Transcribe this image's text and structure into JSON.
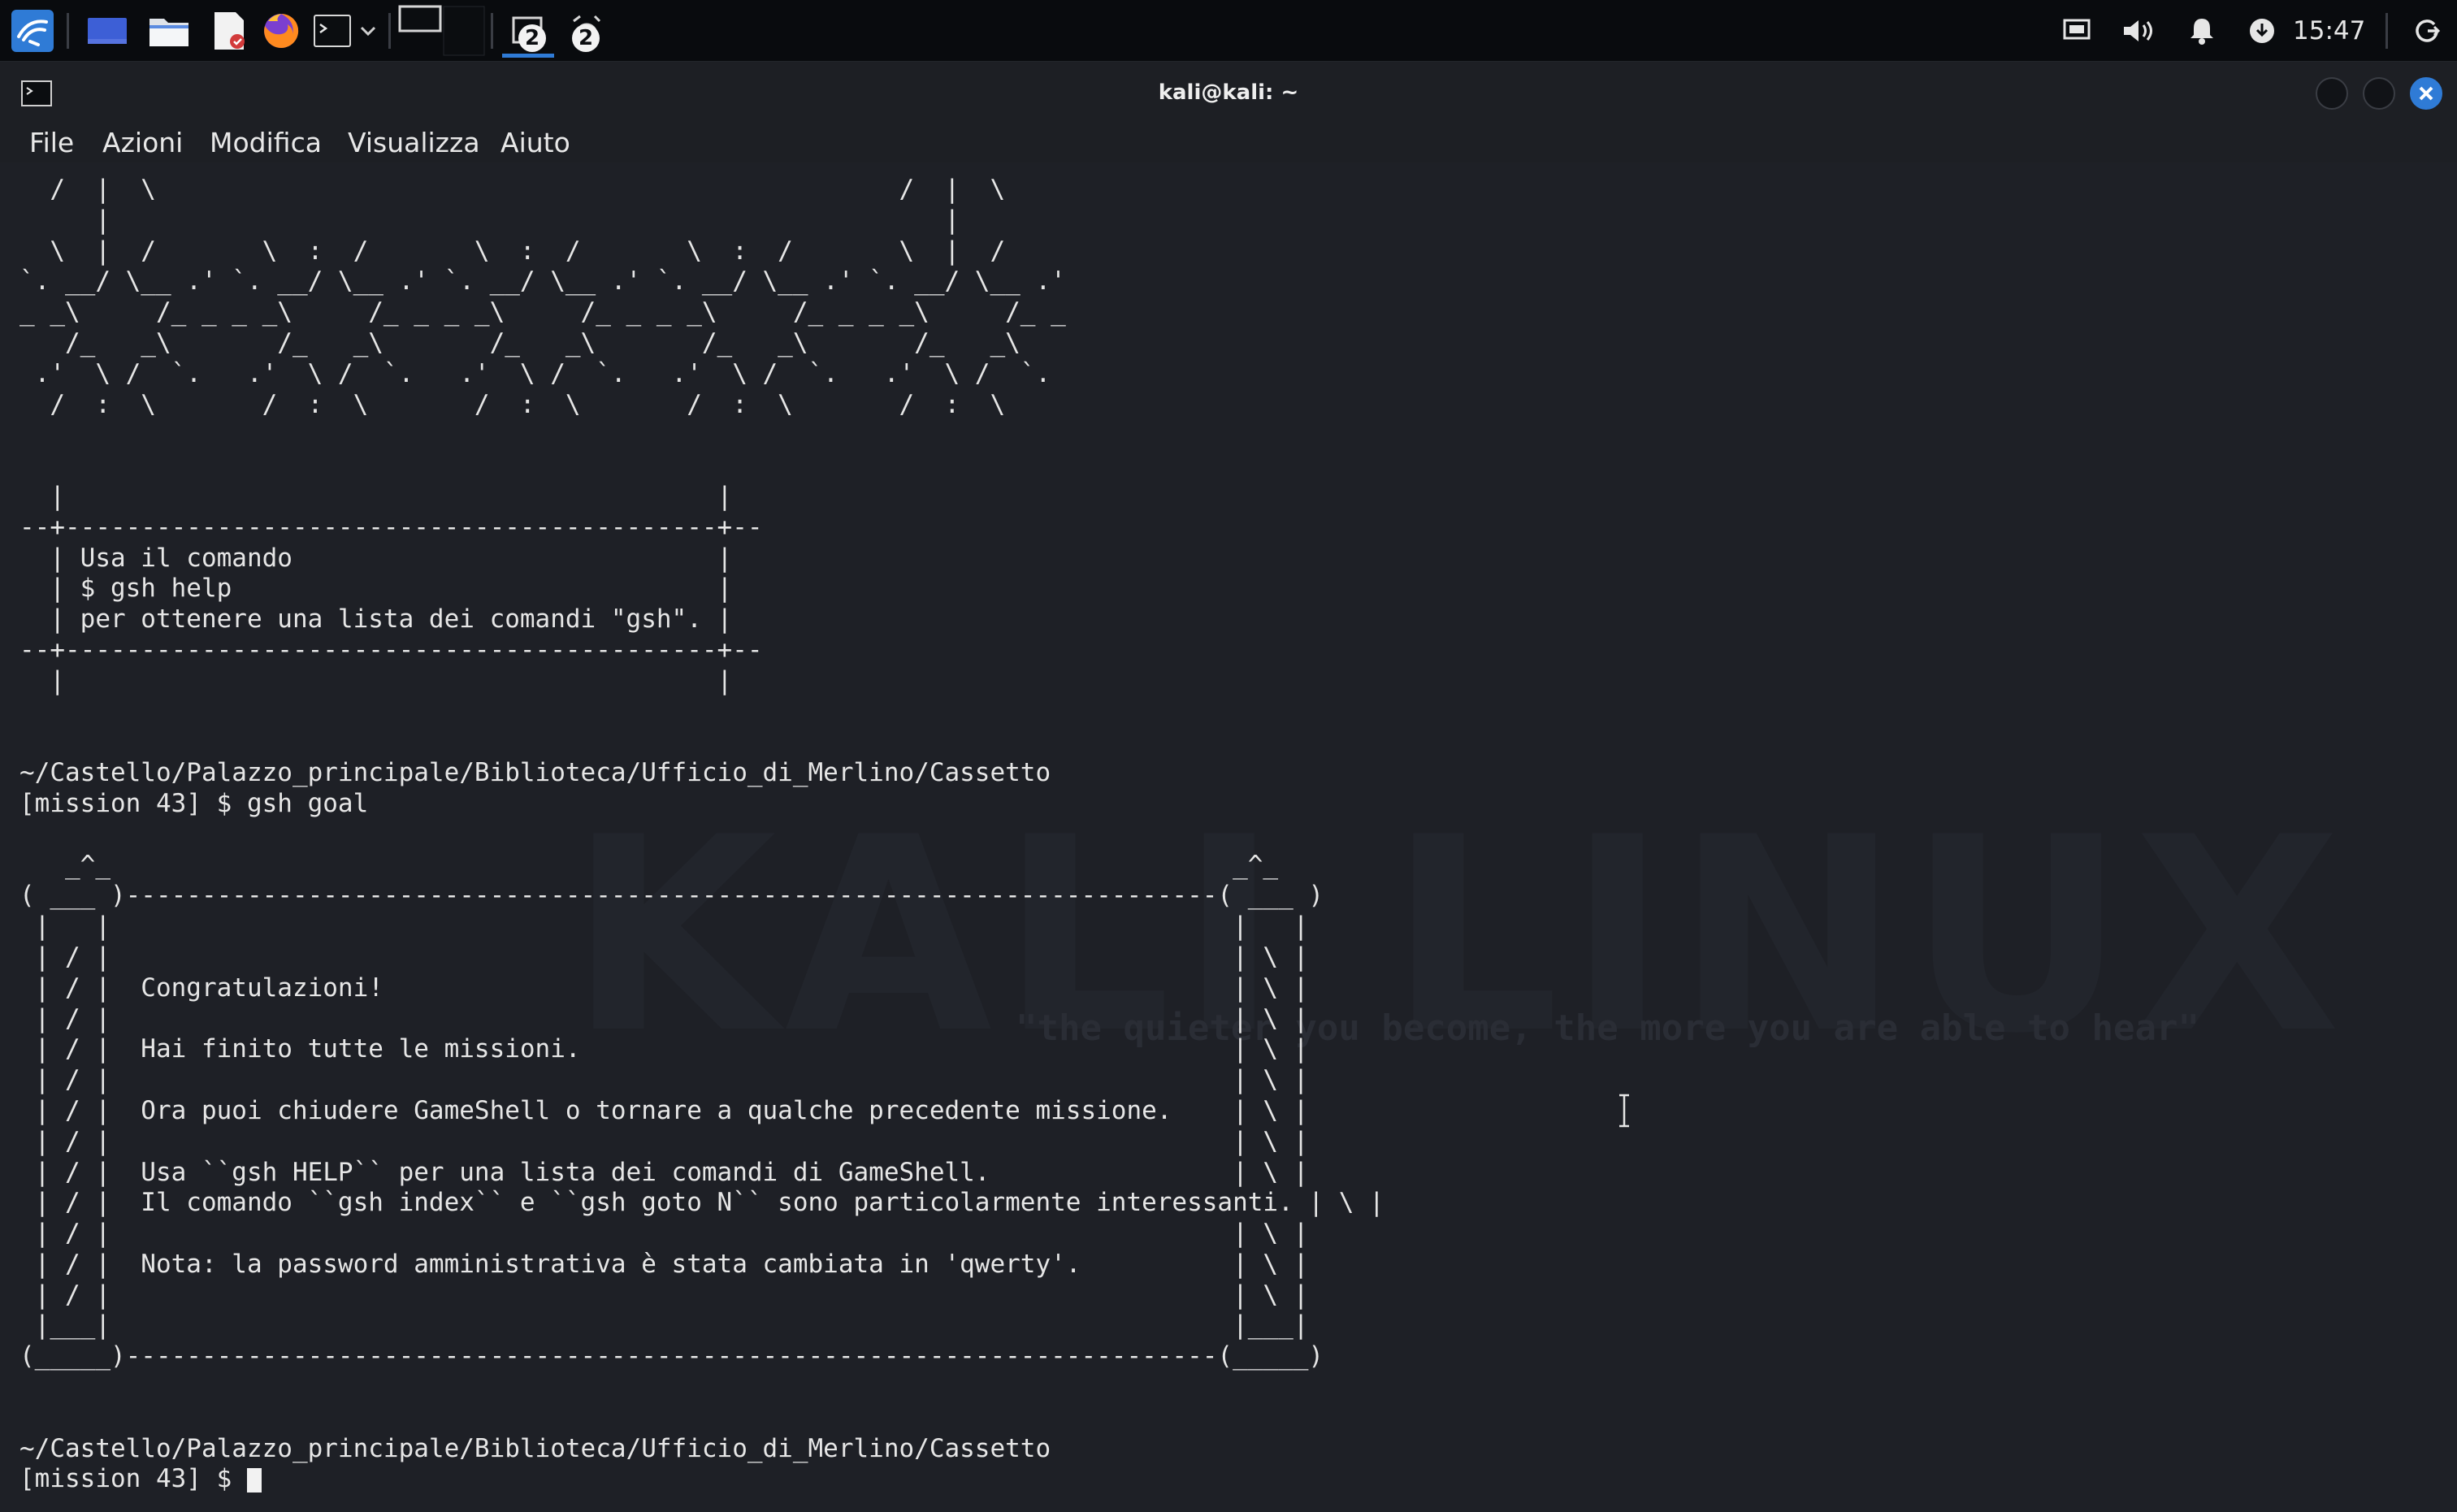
{
  "taskbar": {
    "launchers": [
      {
        "name": "kali-menu-icon"
      },
      {
        "name": "show-desktop-icon"
      },
      {
        "name": "file-manager-icon"
      },
      {
        "name": "text-editor-icon"
      },
      {
        "name": "firefox-icon"
      },
      {
        "name": "terminal-icon"
      }
    ],
    "workspace_count_1": "2",
    "workspace_count_2": "2",
    "clock": "15:47"
  },
  "window": {
    "title": "kali@kali: ~",
    "menu": [
      "File",
      "Azioni",
      "Modifica",
      "Visualizza",
      "Aiuto"
    ]
  },
  "terminal": {
    "lines": [
      "  /  |  \\                                                 /  |  \\",
      "     |                                                       |",
      "  \\  |  /       \\  :  /       \\  :  /       \\  :  /       \\  |  /",
      "`. __/ \\__ .' `. __/ \\__ .' `. __/ \\__ .' `. __/ \\__ .' `. __/ \\__ .'",
      "_ _\\     /_ _ _ _\\     /_ _ _ _\\     /_ _ _ _\\     /_ _ _ _\\     /_ _",
      "   /_   _\\       /_   _\\       /_   _\\       /_   _\\       /_   _\\",
      " .'  \\ /  `.   .'  \\ /  `.   .'  \\ /  `.   .'  \\ /  `.   .'  \\ /  `.",
      "  /  :  \\       /  :  \\       /  :  \\       /  :  \\       /  :  \\",
      "",
      "",
      "  |                                           |",
      "--+-------------------------------------------+--",
      "  | Usa il comando                            |",
      "  | $ gsh help                                |",
      "  | per ottenere una lista dei comandi \"gsh\". |",
      "--+-------------------------------------------+--",
      "  |                                           |",
      "",
      "",
      "~/Castello/Palazzo_principale/Biblioteca/Ufficio_di_Merlino/Cassetto",
      "[mission 43] $ gsh goal",
      "",
      "   _^_                                                                          _^_",
      "( ___ )------------------------------------------------------------------------( ___ )",
      " |   |                                                                          |   |",
      " | / |                                                                          | \\ |",
      " | / |  Congratulazioni!                                                        | \\ |",
      " | / |                                                                          | \\ |",
      " | / |  Hai finito tutte le missioni.                                           | \\ |",
      " | / |                                                                          | \\ |",
      " | / |  Ora puoi chiudere GameShell o tornare a qualche precedente missione.    | \\ |",
      " | / |                                                                          | \\ |",
      " | / |  Usa ``gsh HELP`` per una lista dei comandi di GameShell.                | \\ |",
      " | / |  Il comando ``gsh index`` e ``gsh goto N`` sono particolarmente interessanti. | \\ |",
      " | / |                                                                          | \\ |",
      " | / |  Nota: la password amministrativa è stata cambiata in 'qwerty'.          | \\ |",
      " | / |                                                                          | \\ |",
      " |___|                                                                          |___|",
      "(_____)------------------------------------------------------------------------(_____)",
      "",
      "",
      "~/Castello/Palazzo_principale/Biblioteca/Ufficio_di_Merlino/Cassetto",
      "[mission 43] $ "
    ]
  },
  "colors": {
    "panel_bg": "#090b0e",
    "window_bg": "#1d1f24",
    "terminal_bg": "#1e2026",
    "text": "#e6e6e6",
    "accent": "#2f7bd6"
  }
}
